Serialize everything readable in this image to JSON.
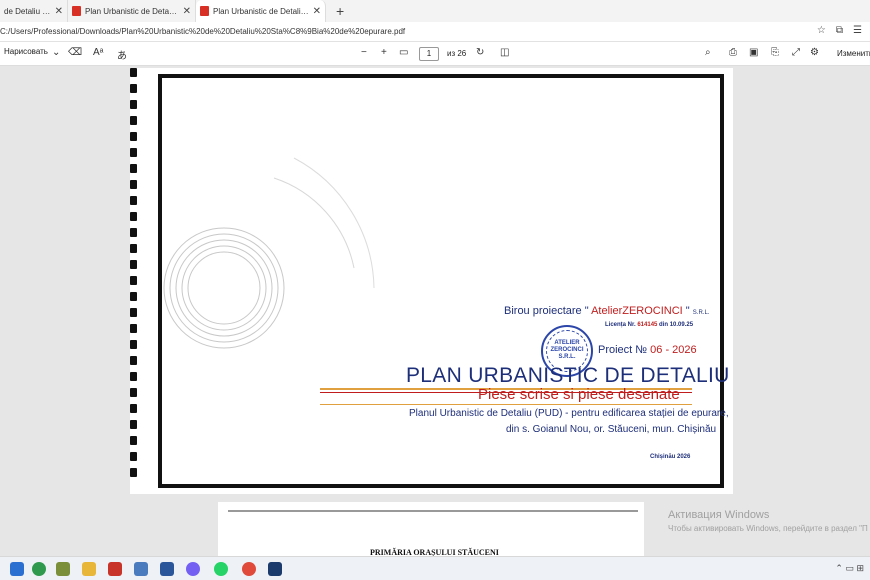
{
  "tabs": [
    {
      "label": "de Detaliu Stația d",
      "active": false
    },
    {
      "label": "Plan Urbanistic de Detaliu Stația d",
      "active": false
    },
    {
      "label": "Plan Urbanistic de Detaliu Stația d",
      "active": true
    }
  ],
  "address": {
    "url": "C:/Users/Professional/Downloads/Plan%20Urbanistic%20de%20Detaliu%20Sta%C8%9Bia%20de%20epurare.pdf"
  },
  "toolbar": {
    "draw_label": "Нарисовать",
    "page_current": "1",
    "page_total": "из 26",
    "edit_label": "Изменить"
  },
  "document": {
    "birou_prefix": "Birou proiectare \" ",
    "birou_name": "AtelierZEROCINCI",
    "birou_suffix": " \"",
    "srl": "S.R.L.",
    "licenta_prefix": "Licența Nr. ",
    "licenta_number": "614145",
    "licenta_date": " din 10.09.25",
    "stamp_line1": "ATELIER",
    "stamp_line2": "ZEROCINCI",
    "stamp_line3": "S.R.L.",
    "proiect_label": "Proiect № ",
    "proiect_number": "06 - 2026",
    "title": "PLAN URBANISTIC DE  DETALIU",
    "subtitle": "Piese scrise si piese desenate",
    "description_line1": "Planul Urbanistic de Detaliu (PUD) - pentru edificarea stației de epurare,",
    "description_line2": "din s. Goianul Nou, or. Stăuceni, mun. Chișinău",
    "place_date": "Chișinău 2026"
  },
  "page2": {
    "heading": "PRIMĂRIA ORAȘULUI STĂUCENI"
  },
  "activation": {
    "title": "Активация Windows",
    "message": "Чтобы активировать Windows, перейдите в раздел \"П"
  }
}
